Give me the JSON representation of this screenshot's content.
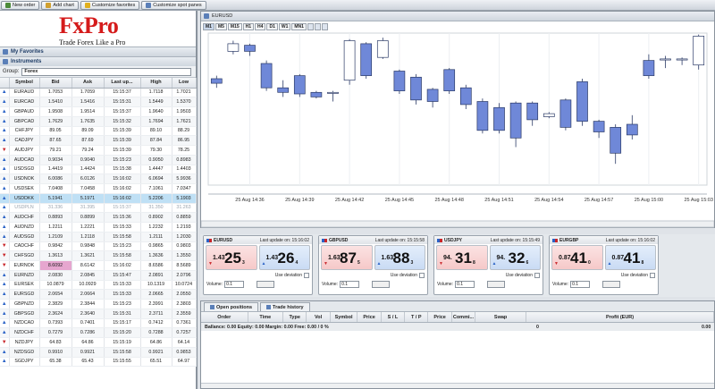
{
  "toolbar": {
    "new_order": "New order",
    "add_chart": "Add chart",
    "customize_favorites": "Customize favorites",
    "customize_spot_panes": "Customize spot panes"
  },
  "logo": {
    "brand": "FxPro",
    "tagline": "Trade Forex Like a Pro"
  },
  "left": {
    "my_favorites": "My Favorites",
    "instruments": "Instruments",
    "group_label": "Group:",
    "group_value": "Forex",
    "columns": [
      "Symbol",
      "Bid",
      "Ask",
      "Last up...",
      "High",
      "Low"
    ],
    "rows": [
      {
        "dir": "up",
        "sym": "EURAUD",
        "bid": "1.7053",
        "ask": "1.7059",
        "t": "15:15:37",
        "hi": "1.7118",
        "lo": "1.7021"
      },
      {
        "dir": "up",
        "sym": "EURCAD",
        "bid": "1.5410",
        "ask": "1.5416",
        "t": "15:15:31",
        "hi": "1.5449",
        "lo": "1.5370"
      },
      {
        "dir": "up",
        "sym": "GBPAUD",
        "bid": "1.9508",
        "ask": "1.9514",
        "t": "15:15:37",
        "hi": "1.9640",
        "lo": "1.9503"
      },
      {
        "dir": "up",
        "sym": "GBPCAD",
        "bid": "1.7629",
        "ask": "1.7635",
        "t": "15:15:32",
        "hi": "1.7694",
        "lo": "1.7621"
      },
      {
        "dir": "up",
        "sym": "CHFJPY",
        "bid": "89.05",
        "ask": "89.09",
        "t": "15:15:39",
        "hi": "89.10",
        "lo": "88.29"
      },
      {
        "dir": "up",
        "sym": "CADJPY",
        "bid": "87.65",
        "ask": "87.69",
        "t": "15:15:39",
        "hi": "87.84",
        "lo": "86.95"
      },
      {
        "dir": "dn",
        "sym": "AUDJPY",
        "bid": "79.21",
        "ask": "79.24",
        "t": "15:15:39",
        "hi": "79.30",
        "lo": "78.25"
      },
      {
        "dir": "up",
        "sym": "AUDCAD",
        "bid": "0.9034",
        "ask": "0.9040",
        "t": "15:15:23",
        "hi": "0.9050",
        "lo": "0.8983"
      },
      {
        "dir": "up",
        "sym": "USDSGD",
        "bid": "1.4419",
        "ask": "1.4424",
        "t": "15:15:38",
        "hi": "1.4447",
        "lo": "1.4403"
      },
      {
        "dir": "up",
        "sym": "USDNOK",
        "bid": "6.0086",
        "ask": "6.0126",
        "t": "15:16:02",
        "hi": "6.0694",
        "lo": "5.9936"
      },
      {
        "dir": "up",
        "sym": "USDSEK",
        "bid": "7.0408",
        "ask": "7.0458",
        "t": "15:16:02",
        "hi": "7.1061",
        "lo": "7.0347"
      },
      {
        "dir": "up",
        "sym": "USDDKK",
        "bid": "5.1941",
        "ask": "5.1971",
        "t": "15:16:02",
        "hi": "5.2206",
        "lo": "5.1903",
        "sel": true
      },
      {
        "dir": "up",
        "sym": "USDPLN",
        "bid": "31.336",
        "ask": "31.395",
        "t": "15:15:37",
        "hi": "31.350",
        "lo": "31.263",
        "dim": true
      },
      {
        "dir": "up",
        "sym": "AUDCHF",
        "bid": "0.8893",
        "ask": "0.8899",
        "t": "15:15:36",
        "hi": "0.8902",
        "lo": "0.8859"
      },
      {
        "dir": "up",
        "sym": "AUDNZD",
        "bid": "1.2211",
        "ask": "1.2221",
        "t": "15:15:33",
        "hi": "1.2232",
        "lo": "1.2193"
      },
      {
        "dir": "up",
        "sym": "AUDSGD",
        "bid": "1.2109",
        "ask": "1.2118",
        "t": "15:15:58",
        "hi": "1.2111",
        "lo": "1.2030"
      },
      {
        "dir": "dn",
        "sym": "CADCHF",
        "bid": "0.9842",
        "ask": "0.9848",
        "t": "15:15:23",
        "hi": "0.9865",
        "lo": "0.9803"
      },
      {
        "dir": "dn",
        "sym": "CHFSGD",
        "bid": "1.3613",
        "ask": "1.3621",
        "t": "15:15:58",
        "hi": "1.3636",
        "lo": "1.3550"
      },
      {
        "dir": "dn",
        "sym": "EURNOK",
        "bid": "8.6092",
        "ask": "8.6142",
        "t": "15:16:02",
        "hi": "8.6586",
        "lo": "8.5689",
        "hl": true
      },
      {
        "dir": "up",
        "sym": "EURNZD",
        "bid": "2.0830",
        "ask": "2.0845",
        "t": "15:15:47",
        "hi": "2.0891",
        "lo": "2.0796"
      },
      {
        "dir": "up",
        "sym": "EURSEK",
        "bid": "10.0879",
        "ask": "10.0929",
        "t": "15:15:33",
        "hi": "10.1319",
        "lo": "10.0724"
      },
      {
        "dir": "up",
        "sym": "EURSGD",
        "bid": "2.0654",
        "ask": "2.0664",
        "t": "15:15:33",
        "hi": "2.0665",
        "lo": "2.0550"
      },
      {
        "dir": "up",
        "sym": "GBPNZD",
        "bid": "2.3829",
        "ask": "2.3844",
        "t": "15:15:23",
        "hi": "2.3991",
        "lo": "2.3803"
      },
      {
        "dir": "up",
        "sym": "GBPSGD",
        "bid": "2.3624",
        "ask": "2.3640",
        "t": "15:15:31",
        "hi": "2.3711",
        "lo": "2.3559"
      },
      {
        "dir": "up",
        "sym": "NZDCAD",
        "bid": "0.7393",
        "ask": "0.7401",
        "t": "15:15:17",
        "hi": "0.7412",
        "lo": "0.7361"
      },
      {
        "dir": "up",
        "sym": "NZDCHF",
        "bid": "0.7279",
        "ask": "0.7286",
        "t": "15:15:20",
        "hi": "0.7288",
        "lo": "0.7257"
      },
      {
        "dir": "dn",
        "sym": "NZDJPY",
        "bid": "64.83",
        "ask": "64.86",
        "t": "15:15:19",
        "hi": "64.86",
        "lo": "64.14"
      },
      {
        "dir": "up",
        "sym": "NZDSGD",
        "bid": "0.9910",
        "ask": "0.9921",
        "t": "15:15:58",
        "hi": "0.9921",
        "lo": "0.9853"
      },
      {
        "dir": "up",
        "sym": "SGDJPY",
        "bid": "65.38",
        "ask": "65.43",
        "t": "15:15:55",
        "hi": "65.51",
        "lo": "64.97"
      }
    ]
  },
  "chart": {
    "title": "EURUSD",
    "timeframes": [
      "M1",
      "M5",
      "M15",
      "H1",
      "H4",
      "D1",
      "W1",
      "MN1"
    ],
    "active_tf": "M1",
    "x_labels": [
      "25 Aug 14:36",
      "25 Aug 14:39",
      "25 Aug 14:42",
      "25 Aug 14:45",
      "25 Aug 14:48",
      "25 Aug 14:51",
      "25 Aug 14:54",
      "25 Aug 14:57",
      "25 Aug 15:00",
      "25 Aug 15:03"
    ]
  },
  "chart_data": {
    "type": "candlestick",
    "title": "EURUSD",
    "x": [
      "14:34",
      "14:35",
      "14:36",
      "14:37",
      "14:38",
      "14:39",
      "14:40",
      "14:41",
      "14:42",
      "14:43",
      "14:44",
      "14:45",
      "14:46",
      "14:47",
      "14:48",
      "14:49",
      "14:50",
      "14:51",
      "14:52",
      "14:53",
      "14:54",
      "14:55",
      "14:56",
      "14:57",
      "14:58",
      "14:59",
      "15:00",
      "15:01",
      "15:02",
      "15:03"
    ],
    "candles": [
      {
        "o": 0.3,
        "c": 0.33,
        "h": 0.36,
        "l": 0.28
      },
      {
        "o": 0.12,
        "c": 0.07,
        "h": 0.14,
        "l": 0.05
      },
      {
        "o": 0.08,
        "c": 0.12,
        "h": 0.15,
        "l": 0.07
      },
      {
        "o": 0.2,
        "c": 0.36,
        "h": 0.38,
        "l": 0.18
      },
      {
        "o": 0.36,
        "c": 0.39,
        "h": 0.42,
        "l": 0.31
      },
      {
        "o": 0.28,
        "c": 0.4,
        "h": 0.42,
        "l": 0.27
      },
      {
        "o": 0.39,
        "c": 0.42,
        "h": 0.43,
        "l": 0.38
      },
      {
        "o": 0.39,
        "c": 0.39,
        "h": 0.45,
        "l": 0.38
      },
      {
        "o": 0.31,
        "c": 0.05,
        "h": 0.34,
        "l": 0.04
      },
      {
        "o": 0.07,
        "c": 0.28,
        "h": 0.3,
        "l": 0.06
      },
      {
        "o": 0.16,
        "c": 0.05,
        "h": 0.17,
        "l": 0.03
      },
      {
        "o": 0.25,
        "c": 0.38,
        "h": 0.4,
        "l": 0.24
      },
      {
        "o": 0.29,
        "c": 0.44,
        "h": 0.47,
        "l": 0.27
      },
      {
        "o": 0.37,
        "c": 0.45,
        "h": 0.49,
        "l": 0.36
      },
      {
        "o": 0.24,
        "c": 0.38,
        "h": 0.4,
        "l": 0.23
      },
      {
        "o": 0.36,
        "c": 0.47,
        "h": 0.5,
        "l": 0.34
      },
      {
        "o": 0.45,
        "c": 0.64,
        "h": 0.66,
        "l": 0.43
      },
      {
        "o": 0.49,
        "c": 0.64,
        "h": 0.66,
        "l": 0.46
      },
      {
        "o": 0.46,
        "c": 0.69,
        "h": 0.75,
        "l": 0.45
      },
      {
        "o": 0.46,
        "c": 0.57,
        "h": 0.61,
        "l": 0.45
      },
      {
        "o": 0.55,
        "c": 0.53,
        "h": 0.56,
        "l": 0.52
      },
      {
        "o": 0.44,
        "c": 0.62,
        "h": 0.64,
        "l": 0.43
      },
      {
        "o": 0.32,
        "c": 0.58,
        "h": 0.61,
        "l": 0.3
      },
      {
        "o": 0.58,
        "c": 0.65,
        "h": 0.69,
        "l": 0.57
      },
      {
        "o": 0.62,
        "c": 0.79,
        "h": 0.86,
        "l": 0.6
      },
      {
        "o": 0.6,
        "c": 0.67,
        "h": 0.7,
        "l": 0.54
      },
      {
        "o": 0.18,
        "c": 0.28,
        "h": 0.3,
        "l": 0.14
      },
      {
        "o": 0.17,
        "c": 0.17,
        "h": 0.23,
        "l": 0.15
      },
      {
        "o": 0.17,
        "c": 0.17,
        "h": 0.21,
        "l": 0.16
      },
      {
        "o": 0.21,
        "c": 0.02,
        "h": 0.24,
        "l": 0.01
      }
    ]
  },
  "spot_panes": [
    {
      "sym": "EURUSD",
      "upd": "Last update on: 15:16:02",
      "bid_small": "1.43",
      "bid_big": "25",
      "bid_pip": "3",
      "ask_small": "1.43",
      "ask_big": "26",
      "ask_pip": "4",
      "dev": "Use deviation",
      "vol_label": "Volume:",
      "vol": "0.1"
    },
    {
      "sym": "GBPUSD",
      "upd": "Last update on: 15:15:58",
      "bid_small": "1.63",
      "bid_big": "87",
      "bid_pip": "5",
      "ask_small": "1.63",
      "ask_big": "88",
      "ask_pip": "3",
      "dev": "Use deviation",
      "vol_label": "Volume:",
      "vol": "0.1"
    },
    {
      "sym": "USDJPY",
      "upd": "Last update on: 15:15:49",
      "bid_small": "94.",
      "bid_big": "31",
      "bid_pip": "8",
      "ask_small": "94.",
      "ask_big": "32",
      "ask_pip": "6",
      "dev": "Use deviation",
      "vol_label": "Volume:",
      "vol": "0.1"
    },
    {
      "sym": "EURGBP",
      "upd": "Last update on: 15:16:02",
      "bid_small": "0.87",
      "bid_big": "41",
      "bid_pip": "0",
      "ask_small": "0.87",
      "ask_big": "41",
      "ask_pip": "8",
      "dev": "Use deviation",
      "vol_label": "Volume:",
      "vol": "0.1"
    }
  ],
  "orders": {
    "tab_open": "Open positions",
    "tab_history": "Trade history",
    "columns": [
      "Order",
      "Time",
      "Type",
      "Vol",
      "Symbol",
      "Price",
      "S / L",
      "T / P",
      "Price",
      "Commi...",
      "Swap",
      "Profit (EUR)"
    ],
    "balance_line": "Ballance: 0.00   Equity: 0.00   Margin: 0.00   Free: 0.00 / 0 %",
    "swap_zero": "0",
    "profit_zero": "0.00"
  },
  "colors": {
    "bull_fill": "#ffffff",
    "bear_fill": "#6f88d8",
    "accent": "#d51b1b"
  }
}
